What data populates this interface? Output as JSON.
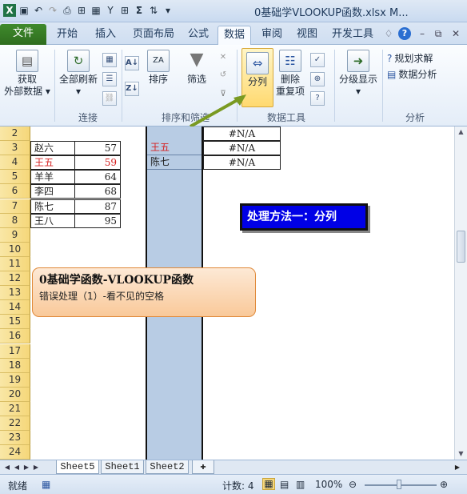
{
  "window": {
    "title": "0基础学VLOOKUP函数.xlsx M..."
  },
  "tabs": {
    "file": "文件",
    "items": [
      "开始",
      "插入",
      "页面布局",
      "公式",
      "数据",
      "审阅",
      "视图",
      "开发工具"
    ],
    "active": "数据"
  },
  "ribbon": {
    "get_external_1": "获取",
    "get_external_2": "外部数据",
    "refresh_all": "全部刷新",
    "sort": "排序",
    "filter": "筛选",
    "text_to_columns": "分列",
    "remove_dup_1": "删除",
    "remove_dup_2": "重复项",
    "outline": "分级显示",
    "solver": "规划求解",
    "data_analysis": "数据分析",
    "groups": {
      "connections": "连接",
      "sort_filter": "排序和筛选",
      "data_tools": "数据工具",
      "analysis": "分析"
    }
  },
  "sheet": {
    "row_numbers": [
      "2",
      "3",
      "4",
      "5",
      "6",
      "7",
      "8",
      "9",
      "10",
      "11",
      "12",
      "13",
      "14",
      "15",
      "16",
      "17",
      "18",
      "19",
      "20",
      "21",
      "22",
      "23",
      "24"
    ],
    "names": [
      "赵六",
      "王五",
      "羊羊",
      "李四",
      "陈七",
      "王八"
    ],
    "scores": [
      "57",
      "59",
      "64",
      "68",
      "87",
      "95"
    ],
    "lookup_names": [
      "王五",
      "陈七"
    ],
    "lookup_results": [
      "#N/A",
      "#N/A",
      "#N/A"
    ],
    "banner": "处理方法一：分列",
    "callout_title": "0基础学函数-VLOOKUP函数",
    "callout_sub": "错误处理（1）-看不见的空格"
  },
  "sheet_tabs": [
    "Sheet5",
    "Sheet1",
    "Sheet2"
  ],
  "status": {
    "ready": "就绪",
    "count": "计数: 4",
    "zoom": "100%"
  },
  "colors": {
    "file_tab": "#2f6d1f",
    "accent_red": "#e0262a",
    "banner_blue": "#0000e6",
    "header_gold": "#f5d77a"
  }
}
